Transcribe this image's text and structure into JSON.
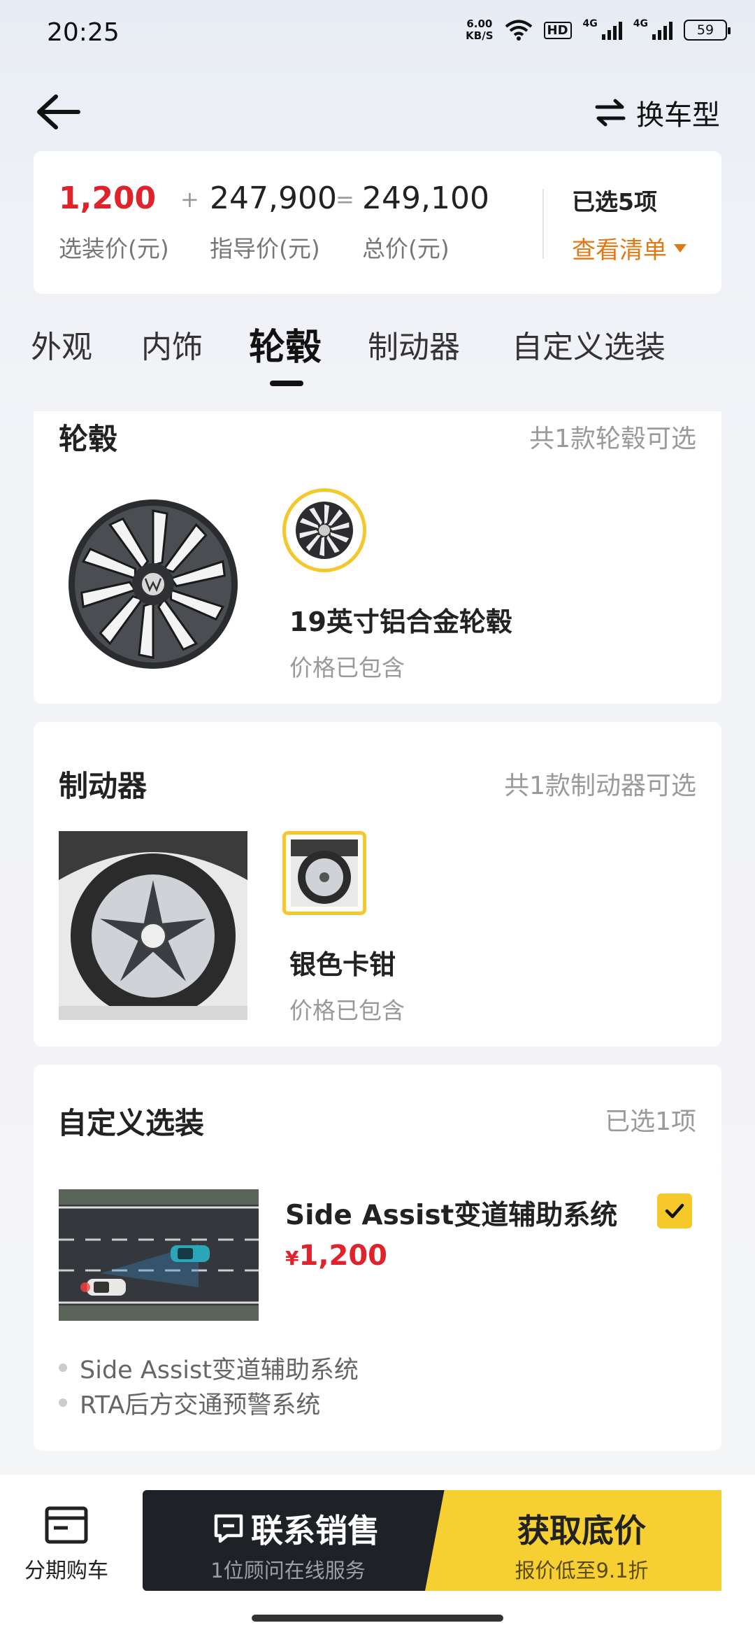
{
  "status_bar": {
    "time": "20:25",
    "net_speed_value": "6.00",
    "net_speed_unit": "KB/S",
    "hd_badge": "HD",
    "signal1_label": "4G",
    "signal2_label": "4G",
    "battery": "59",
    "icons": [
      "wifi-icon",
      "signal-icon",
      "battery-icon"
    ]
  },
  "header": {
    "back_icon": "arrow-left-icon",
    "change_model_icon": "swap-icon",
    "change_model_label": "换车型"
  },
  "price_summary": {
    "option_price": "1,200",
    "option_price_label": "选装价(元)",
    "plus": "+",
    "guide_price": "247,900",
    "guide_price_label": "指导价(元)",
    "equals": "=",
    "total_price": "249,100",
    "total_price_label": "总价(元)",
    "selected_count": "已选5项",
    "view_list": "查看清单",
    "accent_red": "#e0222b",
    "accent_orange": "#e27814"
  },
  "tabs": [
    {
      "label": "外观",
      "active": false
    },
    {
      "label": "内饰",
      "active": false
    },
    {
      "label": "轮毂",
      "active": true
    },
    {
      "label": "制动器",
      "active": false
    },
    {
      "label": "自定义选装",
      "active": false
    }
  ],
  "wheel_section": {
    "title": "轮毂",
    "meta": "共1款轮毂可选",
    "option_name": "19英寸铝合金轮毂",
    "option_price": "价格已包含"
  },
  "brake_section": {
    "title": "制动器",
    "meta": "共1款制动器可选",
    "option_name": "银色卡钳",
    "option_price": "价格已包含"
  },
  "custom_section": {
    "title": "自定义选装",
    "meta": "已选1项",
    "option_name": "Side Assist变道辅助系统",
    "currency": "¥",
    "option_price": "1,200",
    "checked": true,
    "features": [
      "Side Assist变道辅助系统",
      "RTA后方交通预警系统"
    ]
  },
  "bottom_bar": {
    "installment_label": "分期购车",
    "contact_main": "联系销售",
    "contact_sub": "1位顾问在线服务",
    "price_main": "获取底价",
    "price_sub": "报价低至9.1折",
    "brand_yellow": "#f6cf33"
  }
}
